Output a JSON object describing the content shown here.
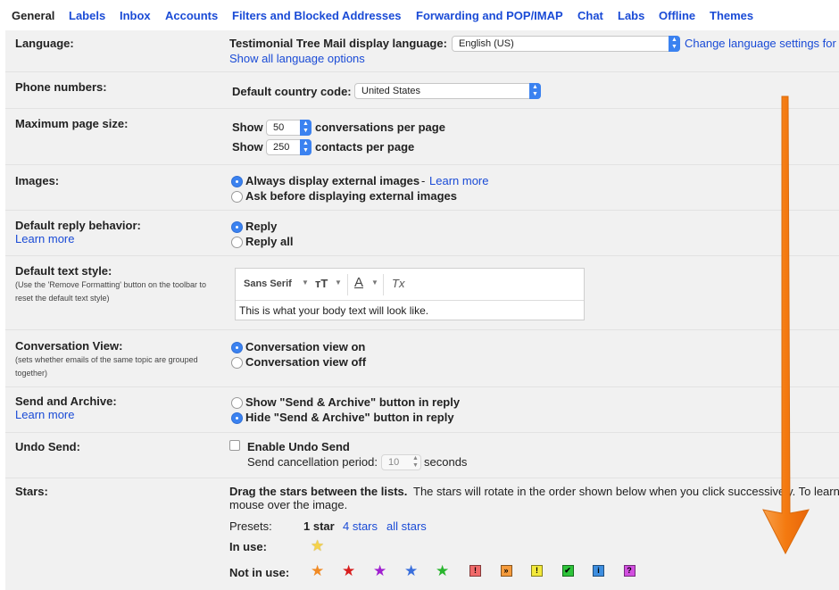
{
  "tabs": [
    "General",
    "Labels",
    "Inbox",
    "Accounts",
    "Filters and Blocked Addresses",
    "Forwarding and POP/IMAP",
    "Chat",
    "Labs",
    "Offline",
    "Themes"
  ],
  "language": {
    "label": "Language:",
    "display_label": "Testimonial Tree Mail display language:",
    "value": "English (US)",
    "change_link": "Change language settings for",
    "show_all": "Show all language options"
  },
  "phone": {
    "label": "Phone numbers:",
    "code_label": "Default country code:",
    "value": "United States"
  },
  "page_size": {
    "label": "Maximum page size:",
    "show": "Show",
    "conv_value": "50",
    "conv_suffix": "conversations per page",
    "contact_value": "250",
    "contact_suffix": "contacts per page"
  },
  "images": {
    "label": "Images:",
    "always": "Always display external images",
    "dash": "-",
    "learn": "Learn more",
    "ask": "Ask before displaying external images"
  },
  "reply": {
    "label": "Default reply behavior:",
    "learn": "Learn more",
    "reply": "Reply",
    "reply_all": "Reply all"
  },
  "text_style": {
    "label": "Default text style:",
    "note": "(Use the 'Remove Formatting' button on the toolbar to reset the default text style)",
    "font": "Sans Serif",
    "size_glyph": "тT",
    "color_glyph": "A",
    "clear_glyph": "Tx",
    "preview": "This is what your body text will look like."
  },
  "conversation": {
    "label": "Conversation View:",
    "note": "(sets whether emails of the same topic are grouped together)",
    "on": "Conversation view on",
    "off": "Conversation view off"
  },
  "send_archive": {
    "label": "Send and Archive:",
    "learn": "Learn more",
    "show": "Show \"Send & Archive\" button in reply",
    "hide": "Hide \"Send & Archive\" button in reply"
  },
  "undo": {
    "label": "Undo Send:",
    "enable": "Enable Undo Send",
    "period": "Send cancellation period:",
    "value": "10",
    "seconds": "seconds"
  },
  "stars": {
    "label": "Stars:",
    "drag": "Drag the stars between the lists.",
    "rotate": "The stars will rotate in the order shown below when you click successively. To learn",
    "mouse": "mouse over the image.",
    "presets": "Presets:",
    "one": "1 star",
    "four": "4 stars",
    "all": "all stars",
    "in_use": "In use:",
    "not_in_use": "Not in use:",
    "in_use_icons": [
      {
        "name": "yellow-star-icon",
        "glyph": "★",
        "color": "#f5d24a"
      }
    ],
    "not_in_use_stars": [
      {
        "name": "orange-star-icon",
        "glyph": "★",
        "color": "#f08a24"
      },
      {
        "name": "red-star-icon",
        "glyph": "★",
        "color": "#d81e1e"
      },
      {
        "name": "purple-star-icon",
        "glyph": "★",
        "color": "#a020d0"
      },
      {
        "name": "blue-star-icon",
        "glyph": "★",
        "color": "#3a6fdc"
      },
      {
        "name": "green-star-icon",
        "glyph": "★",
        "color": "#29b52e"
      }
    ],
    "not_in_use_squares": [
      {
        "name": "red-bang-icon",
        "glyph": "!",
        "color": "#f06a6a"
      },
      {
        "name": "orange-guillemet-icon",
        "glyph": "»",
        "color": "#f59b3c"
      },
      {
        "name": "yellow-bang-icon",
        "glyph": "!",
        "color": "#f3e93a"
      },
      {
        "name": "green-check-icon",
        "glyph": "✔",
        "color": "#2ec43a"
      },
      {
        "name": "blue-info-icon",
        "glyph": "i",
        "color": "#3d8ee0"
      },
      {
        "name": "purple-question-icon",
        "glyph": "?",
        "color": "#d24fe0"
      }
    ]
  },
  "colors": {
    "accent": "#1a4bd6",
    "panel": "#f1f1f1",
    "arrow": "#f47a10"
  }
}
